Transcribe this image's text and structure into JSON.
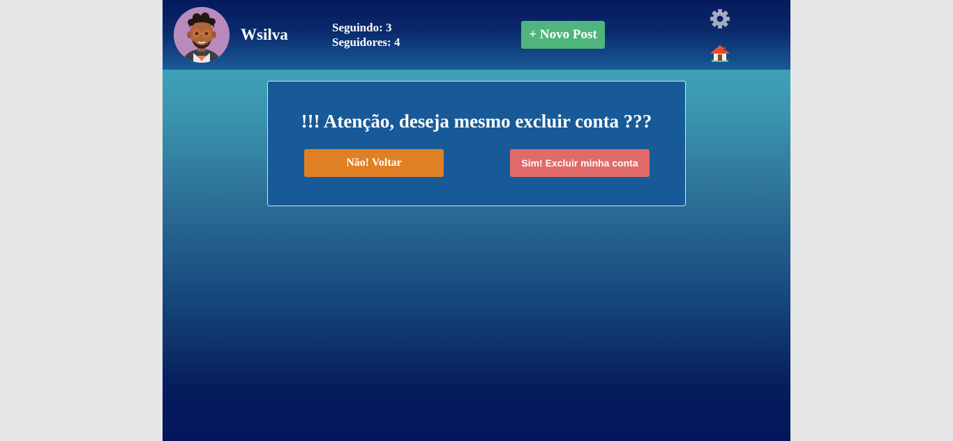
{
  "header": {
    "username": "Wsilva",
    "following_label": "Seguindo: 3",
    "followers_label": "Seguidores: 4",
    "new_post_label": "+ Novo Post",
    "icons": [
      "avatar",
      "gear-icon",
      "home-icon"
    ]
  },
  "dialog": {
    "title": "!!! Atenção, deseja mesmo excluir conta ???",
    "cancel_label": "Não! Voltar",
    "confirm_label": "Sim! Excluir minha conta"
  },
  "colors": {
    "new_post_button": "#4fb57d",
    "cancel_button": "#e08025",
    "confirm_button": "#e16a6a",
    "dialog_background": "#185a97",
    "header_background": "#041a5c"
  }
}
